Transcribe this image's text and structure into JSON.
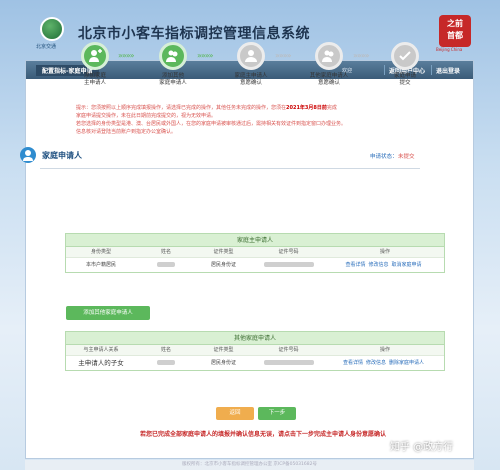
{
  "header": {
    "app_title": "北京市小客车指标调控管理信息系统",
    "logo_caption": "北京交通",
    "seal_text": "之前 首都",
    "seal_caption": "Beijing China"
  },
  "navbar": {
    "breadcrumb": "配置指标-家庭申请",
    "welcome": "欢迎",
    "home_label": "返回用户中心",
    "logout_label": "退出登录"
  },
  "steps": [
    {
      "line1": "添加家庭",
      "line2": "主申请人",
      "state": "done",
      "icon": "add-user-icon"
    },
    {
      "line1": "添加其他",
      "line2": "家庭申请人",
      "state": "done",
      "icon": "add-users-icon"
    },
    {
      "line1": "家庭主申请人",
      "line2": "意愿确认",
      "state": "todo",
      "icon": "user-check-icon"
    },
    {
      "line1": "其他家庭申请人",
      "line2": "意愿确认",
      "state": "todo",
      "icon": "users-check-icon"
    },
    {
      "line1": "家庭申请",
      "line2": "提交",
      "state": "todo",
      "icon": "check-icon"
    }
  ],
  "notice": {
    "line1_a": "提示：您须按照以上顺序完成填报操作，请选择已完成的操作，其他任务未完成的操作，您须在",
    "line1_date": "2021年3月8日前",
    "line1_b": "完成",
    "line2": "家庭申请提交操作，未在此日期前完成提交的，视为无效申请。",
    "line3": "若您选择的身份类型是港、澳、台居民或外国人，在您的家庭申请被审核通过后，需持相关有效证件到指定窗口办理业务。",
    "line4": "信息核对请登陆当前账户到指定办公室确认。"
  },
  "section": {
    "title": "家庭申请人",
    "status_label": "申请状态：",
    "status_value": "未提交"
  },
  "main_applicant_table": {
    "caption": "家庭主申请人",
    "headers": [
      "身份类型",
      "姓名",
      "证件类型",
      "证件号码",
      "操作"
    ],
    "row": {
      "identity": "本市户籍居民",
      "id_type": "居民身份证",
      "actions": [
        "查看详情",
        "修改信息",
        "取消家庭申请"
      ]
    }
  },
  "add_button": "添加其他家庭申请人",
  "other_applicants_table": {
    "caption": "其他家庭申请人",
    "headers": [
      "与主申请人关系",
      "姓名",
      "证件类型",
      "证件号码",
      "操作"
    ],
    "row": {
      "relation": "主申请人的子女",
      "id_type": "居民身份证",
      "actions": [
        "查看详情",
        "修改信息",
        "删除家庭申请人"
      ]
    }
  },
  "buttons": {
    "back": "返回",
    "next": "下一步"
  },
  "bottom_note": "若您已完成全部家庭申请人的填报并确认信息无误，请点击下一步完成主申请人身份意愿确认",
  "footer": "版权所有：北京市小客车指标调控管理办公室  京ICP备05031682号",
  "watermark": "知乎 @政方行",
  "colors": {
    "done": "#5cb85c",
    "todo": "#c9c9c9",
    "nav": "#3b5b78",
    "alert": "#d9534f"
  }
}
